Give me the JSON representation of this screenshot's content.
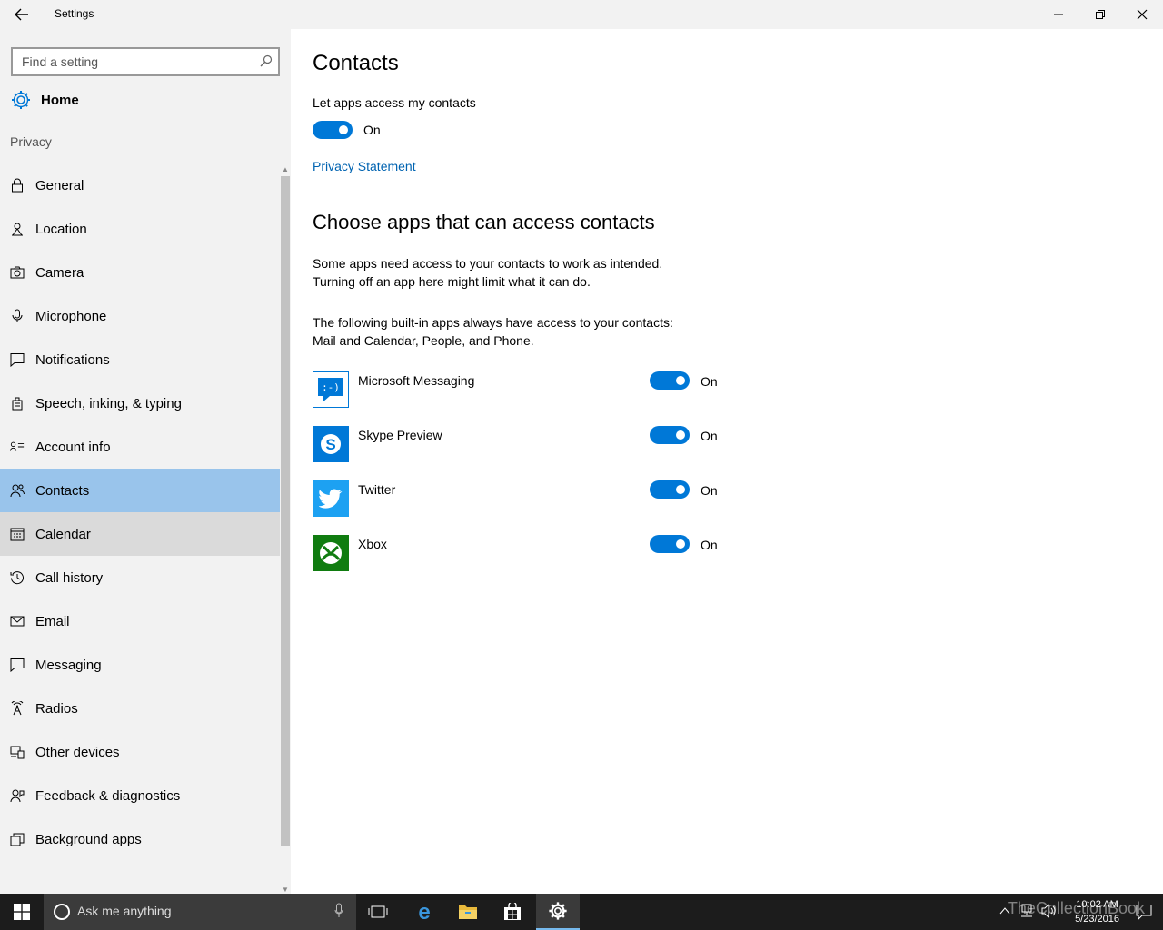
{
  "window": {
    "title": "Settings",
    "controls": {
      "minimize": "minimize-icon",
      "maximize": "restore-icon",
      "close": "close-icon"
    }
  },
  "sidebar": {
    "search_placeholder": "Find a setting",
    "home_label": "Home",
    "section_label": "Privacy",
    "items": [
      {
        "label": "General",
        "icon": "lock-icon"
      },
      {
        "label": "Location",
        "icon": "location-icon"
      },
      {
        "label": "Camera",
        "icon": "camera-icon"
      },
      {
        "label": "Microphone",
        "icon": "microphone-icon"
      },
      {
        "label": "Notifications",
        "icon": "notifications-icon"
      },
      {
        "label": "Speech, inking, & typing",
        "icon": "speech-icon"
      },
      {
        "label": "Account info",
        "icon": "account-info-icon"
      },
      {
        "label": "Contacts",
        "icon": "contacts-icon",
        "state": "selected"
      },
      {
        "label": "Calendar",
        "icon": "calendar-icon",
        "state": "hover"
      },
      {
        "label": "Call history",
        "icon": "history-icon"
      },
      {
        "label": "Email",
        "icon": "email-icon"
      },
      {
        "label": "Messaging",
        "icon": "messaging-icon"
      },
      {
        "label": "Radios",
        "icon": "radios-icon"
      },
      {
        "label": "Other devices",
        "icon": "other-devices-icon"
      },
      {
        "label": "Feedback & diagnostics",
        "icon": "feedback-icon"
      },
      {
        "label": "Background apps",
        "icon": "background-apps-icon"
      }
    ]
  },
  "main": {
    "title": "Contacts",
    "access_label": "Let apps access my contacts",
    "access_state": "On",
    "privacy_link": "Privacy Statement",
    "choose_heading": "Choose apps that can access contacts",
    "para1_line1": "Some apps need access to your contacts to work as intended.",
    "para1_line2": "Turning off an app here might limit what it can do.",
    "para2_line1": "The following built-in apps always have access to your contacts:",
    "para2_line2": "Mail and Calendar, People, and Phone.",
    "apps": [
      {
        "name": "Microsoft Messaging",
        "state": "On",
        "icon": "messaging-app-icon",
        "color": "#0078d7"
      },
      {
        "name": "Skype Preview",
        "state": "On",
        "icon": "skype-icon",
        "color": "#0078d7"
      },
      {
        "name": "Twitter",
        "state": "On",
        "icon": "twitter-icon",
        "color": "#1da1f2"
      },
      {
        "name": "Xbox",
        "state": "On",
        "icon": "xbox-icon",
        "color": "#107c10"
      }
    ]
  },
  "taskbar": {
    "search_placeholder": "Ask me anything",
    "time": "10:02 AM",
    "date": "5/23/2016",
    "watermark": "TheCollectionBook"
  },
  "colors": {
    "accent": "#0078d7",
    "selected": "#99c4eb",
    "sidebar_bg": "#f2f2f2",
    "link": "#0063b1"
  }
}
